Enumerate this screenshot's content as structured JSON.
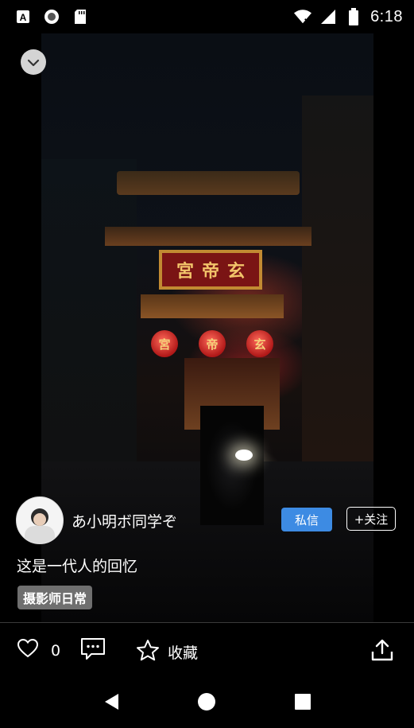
{
  "status_bar": {
    "time": "6:18",
    "left_icons": [
      "a-box-icon",
      "record-icon",
      "sd-card-icon"
    ],
    "right_icons": [
      "wifi-icon",
      "signal-icon",
      "battery-icon"
    ]
  },
  "photo": {
    "sign_chars": [
      "宮",
      "帝",
      "玄"
    ],
    "lantern_chars": [
      "宮",
      "帝",
      "玄"
    ]
  },
  "author": {
    "name": "あ小明ボ同学ぞ"
  },
  "buttons": {
    "private_message": "私信",
    "follow": "+关注"
  },
  "post": {
    "caption": "这是一代人的回忆",
    "tag": "摄影师日常"
  },
  "actions": {
    "like_count": "0",
    "favorite_label": "收藏"
  },
  "colors": {
    "accent_blue": "#3d8be3",
    "tag_gray": "#6f6f6f",
    "background": "#000000"
  }
}
